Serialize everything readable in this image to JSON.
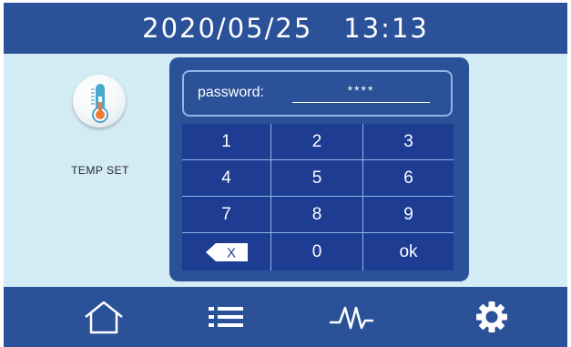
{
  "header": {
    "date": "2020/05/25",
    "time": "13:13"
  },
  "temp_set": {
    "label": "TEMP SET",
    "icon": "thermometer-icon"
  },
  "password": {
    "label": "password:",
    "masked_value": "****"
  },
  "keypad": {
    "keys": [
      "1",
      "2",
      "3",
      "4",
      "5",
      "6",
      "7",
      "8",
      "9"
    ],
    "backspace": "X",
    "zero": "0",
    "ok": "ok"
  },
  "footer": {
    "items": [
      {
        "icon": "home-icon"
      },
      {
        "icon": "list-icon"
      },
      {
        "icon": "waveform-icon"
      },
      {
        "icon": "gear-icon"
      }
    ]
  },
  "colors": {
    "primary": "#2b5199",
    "key_bg": "#1d3c92",
    "panel_bg": "#d3ebf5",
    "divider": "#8fb7e6"
  }
}
